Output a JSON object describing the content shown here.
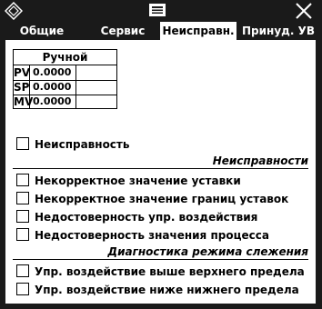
{
  "titlebar": {
    "diamond_icon": "diamond-icon",
    "menu_icon": "menu-icon",
    "close_icon": "close-icon"
  },
  "tabs": [
    {
      "label": "Общие",
      "active": false
    },
    {
      "label": "Сервис",
      "active": false
    },
    {
      "label": "Неисправн.",
      "active": true
    },
    {
      "label": "Принуд. УВ",
      "active": false
    }
  ],
  "manual_table": {
    "title": "Ручной",
    "rows": [
      {
        "label": "PV",
        "value": "0.0000"
      },
      {
        "label": "SP",
        "value": "0.0000"
      },
      {
        "label": "MV",
        "value": "0.0000"
      }
    ]
  },
  "fault_checkbox": {
    "label": "Неисправность",
    "checked": false
  },
  "faults_section": {
    "title": "Неисправности",
    "items": [
      {
        "label": "Некорректное значение уставки",
        "checked": false
      },
      {
        "label": "Некорректное значение границ уставок",
        "checked": false
      },
      {
        "label": "Недостоверность упр. воздействия",
        "checked": false
      },
      {
        "label": "Недостоверность значения процесса",
        "checked": false
      }
    ]
  },
  "tracking_section": {
    "title": "Диагностика режима слежения",
    "items": [
      {
        "label": "Упр. воздействие выше верхнего предела",
        "checked": false
      },
      {
        "label": "Упр. воздействие ниже нижнего предела",
        "checked": false
      }
    ]
  },
  "colors": {
    "frame": "#1a1a1a",
    "panel": "#ffffff",
    "text": "#000000"
  }
}
